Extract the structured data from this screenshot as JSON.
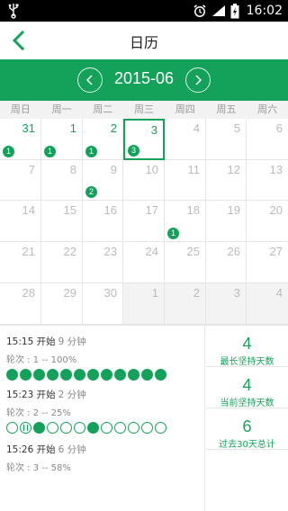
{
  "status_bar": {
    "time": "16:02",
    "icons": [
      "usb-icon",
      "alarm-icon",
      "signal-icon",
      "battery-icon"
    ]
  },
  "nav": {
    "title": "日历",
    "back_icon": "back-arrow-icon"
  },
  "month_header": {
    "label": "2015-06",
    "prev_icon": "chevron-left-icon",
    "next_icon": "chevron-right-icon"
  },
  "weekdays": [
    "周日",
    "周一",
    "周二",
    "周三",
    "周四",
    "周五",
    "周六"
  ],
  "calendar": {
    "selected_day": "3",
    "rows": [
      [
        {
          "day": "31",
          "current": true,
          "badge": "1"
        },
        {
          "day": "1",
          "current": true,
          "badge": "1"
        },
        {
          "day": "2",
          "current": true,
          "badge": "1"
        },
        {
          "day": "3",
          "current": true,
          "badge": "3"
        },
        {
          "day": "4",
          "current": false,
          "badge": ""
        },
        {
          "day": "5",
          "current": false,
          "badge": ""
        },
        {
          "day": "6",
          "current": false,
          "badge": ""
        }
      ],
      [
        {
          "day": "7",
          "current": false,
          "badge": ""
        },
        {
          "day": "8",
          "current": false,
          "badge": ""
        },
        {
          "day": "9",
          "current": false,
          "badge": "2"
        },
        {
          "day": "10",
          "current": false,
          "badge": ""
        },
        {
          "day": "11",
          "current": false,
          "badge": ""
        },
        {
          "day": "12",
          "current": false,
          "badge": ""
        },
        {
          "day": "13",
          "current": false,
          "badge": ""
        }
      ],
      [
        {
          "day": "14",
          "current": false,
          "badge": ""
        },
        {
          "day": "15",
          "current": false,
          "badge": ""
        },
        {
          "day": "16",
          "current": false,
          "badge": ""
        },
        {
          "day": "17",
          "current": false,
          "badge": ""
        },
        {
          "day": "18",
          "current": false,
          "badge": "1"
        },
        {
          "day": "19",
          "current": false,
          "badge": ""
        },
        {
          "day": "20",
          "current": false,
          "badge": ""
        }
      ],
      [
        {
          "day": "21",
          "current": false,
          "badge": ""
        },
        {
          "day": "22",
          "current": false,
          "badge": ""
        },
        {
          "day": "23",
          "current": false,
          "badge": ""
        },
        {
          "day": "24",
          "current": false,
          "badge": ""
        },
        {
          "day": "25",
          "current": false,
          "badge": ""
        },
        {
          "day": "26",
          "current": false,
          "badge": ""
        },
        {
          "day": "27",
          "current": false,
          "badge": ""
        }
      ],
      [
        {
          "day": "28",
          "current": false,
          "badge": ""
        },
        {
          "day": "29",
          "current": false,
          "badge": ""
        },
        {
          "day": "30",
          "current": false,
          "badge": ""
        },
        {
          "day": "1",
          "current": false,
          "other": true,
          "badge": ""
        },
        {
          "day": "2",
          "current": false,
          "other": true,
          "badge": ""
        },
        {
          "day": "3",
          "current": false,
          "other": true,
          "badge": ""
        },
        {
          "day": "4",
          "current": false,
          "other": true,
          "badge": ""
        }
      ]
    ]
  },
  "sessions": [
    {
      "start_label": "15:15 开始",
      "duration_label": "9 分钟",
      "rounds_label": "轮次 : 1 -- 100%",
      "dots": [
        "on",
        "on",
        "on",
        "on",
        "on",
        "on",
        "on",
        "on",
        "on",
        "on",
        "on",
        "on"
      ]
    },
    {
      "start_label": "15:23 开始",
      "duration_label": "2 分钟",
      "rounds_label": "轮次 : 2 -- 25%",
      "dots": [
        "off",
        "cur",
        "on",
        "off",
        "off",
        "off",
        "on",
        "off",
        "off",
        "off",
        "off",
        "off"
      ]
    },
    {
      "start_label": "15:26 开始",
      "duration_label": "6 分钟",
      "rounds_label": "轮次 : 3 -- 58%",
      "dots": []
    }
  ],
  "stats": [
    {
      "value": "4",
      "label": "最长坚持天数"
    },
    {
      "value": "4",
      "label": "当前坚持天数"
    },
    {
      "value": "6",
      "label": "过去30天总计"
    }
  ],
  "colors": {
    "accent": "#14a25a",
    "status_bar": "#000000"
  }
}
